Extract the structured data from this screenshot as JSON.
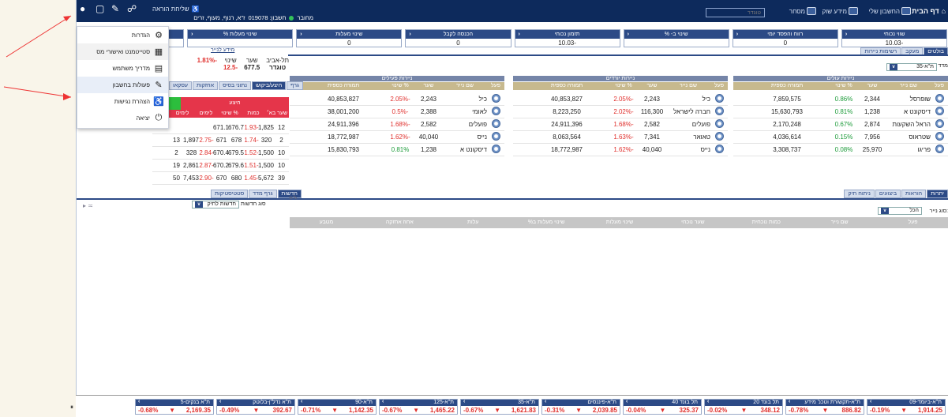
{
  "topbar": {
    "home": "דף הבית",
    "account": "החשבון שלי",
    "market": "מידע שוק",
    "trade": "מסחר",
    "search_placeholder": "טוגדר",
    "send_order": "שליחת הוראה",
    "account_label": "ז\"א, רנוף, מעוף, זרים",
    "account_no": "חשבון: 019078",
    "connected": "מחובר"
  },
  "summary": [
    {
      "label": "שווי נכוחי",
      "value": "-10.03"
    },
    {
      "label": "רווח והפסד יומי",
      "value": "0"
    },
    {
      "label": "שינוי ב- %",
      "value": ""
    },
    {
      "label": "תזמון נכוחי",
      "value": "-10.03"
    },
    {
      "label": "הכנסה לקבל",
      "value": "0"
    },
    {
      "label": "שינוי מעלות",
      "value": "0"
    },
    {
      "label": "שינוי מעלות %",
      "value": ""
    },
    {
      "label": "",
      "value": ""
    }
  ],
  "right_tabs": [
    "בולטים",
    "מעקב",
    "רשימות ניירות"
  ],
  "index_dd": "ת\"א-35",
  "index_lbl": "מדד",
  "tables": [
    {
      "title": "ניירות עולים",
      "cols": [
        "פעל",
        "שם נייר",
        "שער",
        "% שינוי",
        "תמורה כספית"
      ],
      "rows": [
        [
          "שופרסל",
          "2,344",
          "0.86%",
          "7,859,575"
        ],
        [
          "דיסקונט א",
          "1,238",
          "0.81%",
          "15,630,793"
        ],
        [
          "הראל השקעות",
          "2,874",
          "0.67%",
          "2,170,248"
        ],
        [
          "שטראוס",
          "7,956",
          "0.15%",
          "4,036,614"
        ],
        [
          "פריגו",
          "25,970",
          "0.08%",
          "3,308,737"
        ]
      ]
    },
    {
      "title": "ניירות יורדים",
      "cols": [
        "פעל",
        "שם נייר",
        "שער",
        "% שינוי",
        "תמורה כספית"
      ],
      "rows": [
        [
          "כיל",
          "2,243",
          "-2.05%",
          "40,853,827"
        ],
        [
          "חברה לישראל",
          "116,300",
          "-2.02%",
          "8,223,250"
        ],
        [
          "פועלים",
          "2,582",
          "-1.68%",
          "24,911,396"
        ],
        [
          "טאואר",
          "7,341",
          "-1.63%",
          "8,063,564"
        ],
        [
          "נייס",
          "40,040",
          "-1.62%",
          "18,772,987"
        ]
      ]
    },
    {
      "title": "ניירות פעילים",
      "cols": [
        "פעל",
        "שם נייר",
        "שער",
        "% שינוי",
        "תמורה כספית"
      ],
      "rows": [
        [
          "כיל",
          "2,243",
          "-2.05%",
          "40,853,827"
        ],
        [
          "לאומי",
          "2,388",
          "-0.5%",
          "38,001,200"
        ],
        [
          "פועלים",
          "2,582",
          "-1.68%",
          "24,911,396"
        ],
        [
          "נייס",
          "40,040",
          "-1.62%",
          "18,772,987"
        ],
        [
          "דיסקונט א",
          "1,238",
          "0.81%",
          "15,830,793"
        ]
      ]
    }
  ],
  "depth": {
    "info": "מידע לנייר",
    "exch": "תל-אביב",
    "name": "טוגדר",
    "rate_lbl": "שער",
    "rate": "677.5",
    "chg_lbl": "שינוי",
    "chg": "-12.5",
    "pct": "-1.81%",
    "tabs": [
      "גרף",
      "היצע/ביקוש",
      "נתוני בסיס",
      "אחזקות",
      "עסקאו"
    ],
    "offer": "היצע",
    "hdr": [
      "שער בא׳",
      "כמות",
      "% שינוי",
      "לימים",
      "לימים"
    ],
    "rows": [
      [
        "12",
        "1,825",
        "-1.93",
        "676.7",
        "671.1"
      ],
      [
        "2",
        "320",
        "-1.74",
        "678",
        "671",
        "-2.75",
        "1,897",
        "13"
      ],
      [
        "10",
        "1,500",
        "-1.52",
        "679.5",
        "670.4",
        "-2.84",
        "328",
        "2"
      ],
      [
        "10",
        "1,500",
        "-1.51",
        "679.6",
        "670.2",
        "-2.87",
        "2,861",
        "19"
      ],
      [
        "39",
        "5,672",
        "-1.45",
        "680",
        "670",
        "-2.90",
        "7,453",
        "50"
      ]
    ]
  },
  "news": {
    "tabs": [
      "חדשות",
      "גרף מדד",
      "סטטיסטיקות"
    ],
    "type_lbl": "סוג חדשות",
    "type": "חדשות לתיק"
  },
  "portfolio": {
    "tabs": [
      "יתרות",
      "הוראות",
      "ביצועים",
      "ניתוח תיק"
    ],
    "type_lbl": "סוג נייר:",
    "type": "הכל",
    "cols": [
      "פעל",
      "שם נייר",
      "כמות נוכחית",
      "שער נוכחי",
      "שינוי מעלות",
      "שינוי מעלות ב%",
      "עלות",
      "אחוז אחזקה",
      "מטבע"
    ]
  },
  "menu": [
    {
      "label": "הגדרות",
      "icon": "gear-icon"
    },
    {
      "label": "סטייטמנט ואישורי מס",
      "icon": "table-icon"
    },
    {
      "label": "מדריך משתמש",
      "icon": "book-icon"
    },
    {
      "label": "פעולות בחשבון",
      "icon": "edit-icon"
    },
    {
      "label": "הצהרת נגישות",
      "icon": "accessibility-icon"
    },
    {
      "label": "יציאה",
      "icon": "power-icon"
    }
  ],
  "tickers": [
    {
      "name": "ת\"א-ביומד-09",
      "pct": "-0.19%",
      "val": "1,914.25"
    },
    {
      "name": "ת\"א-תקשורת וטכנ' מידע",
      "pct": "-0.78%",
      "val": "886.82"
    },
    {
      "name": "תל בונד 20",
      "pct": "-0.02%",
      "val": "348.12"
    },
    {
      "name": "תל בונד 40",
      "pct": "-0.04%",
      "val": "325.37"
    },
    {
      "name": "ת\"א-פיננסים",
      "pct": "-0.31%",
      "val": "2,039.85"
    },
    {
      "name": "ת\"א-35",
      "pct": "-0.67%",
      "val": "1,621.83"
    },
    {
      "name": "ת\"א-125",
      "pct": "-0.67%",
      "val": "1,465.22"
    },
    {
      "name": "ת\"א-90",
      "pct": "-0.71%",
      "val": "1,142.35"
    },
    {
      "name": "ת\"א נדל\"ן-בלוטק",
      "pct": "-0.49%",
      "val": "392.67"
    },
    {
      "name": "ת\"א בנקים-5",
      "pct": "-0.68%",
      "val": "2,169.35"
    }
  ]
}
